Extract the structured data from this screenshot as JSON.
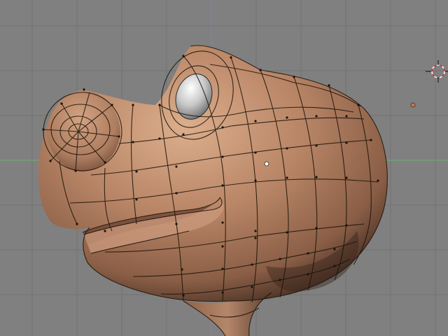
{
  "viewport": {
    "kind": "3d-modeling-viewport",
    "view": "side",
    "colors": {
      "background": "#808080",
      "grid_line": "#727272",
      "axis_x": "#6fae6f",
      "axis_z": "#8c8cd0",
      "mesh_surface": "#b07d5e",
      "mesh_highlight": "#d8a884",
      "mesh_shadow": "#3e2a20",
      "wireframe": "#1a1208",
      "eye": "#c9c9c9",
      "cursor_ring": "#d03030"
    },
    "object": {
      "name_icon": "character-head-mesh"
    },
    "cursor": {
      "icon": "3d-cursor-icon"
    },
    "light": {
      "icon": "lamp-origin-icon"
    }
  }
}
